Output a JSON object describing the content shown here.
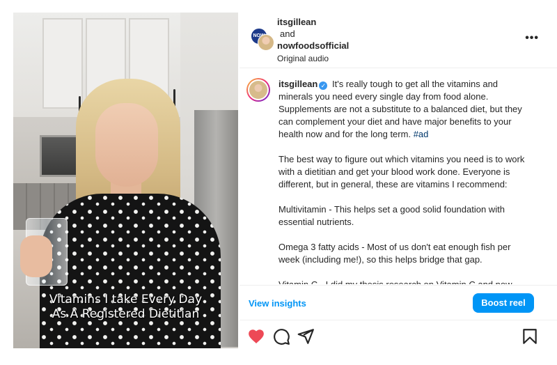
{
  "media": {
    "caption_line1": "Vitamins I take Every Day",
    "caption_line2": "As A Registered Dietitian"
  },
  "header": {
    "author1": "itsgillean",
    "joiner": "and",
    "author2": "nowfoodsofficial",
    "audio": "Original audio",
    "brand_avatar_text": "NOW",
    "more_icon": "more-horizontal-icon"
  },
  "post": {
    "username": "itsgillean",
    "verified_icon": "verified-badge-icon",
    "para1": "It's really tough to get all the vitamins and minerals you need every single day from food alone. Supplements are not a substitute to a balanced diet, but they can complement your diet and have major benefits to your health now and for the long term.",
    "hashtag": "#ad",
    "para2": "The best way to figure out which vitamins you need is to work with a dietitian and get your blood work done. Everyone is different, but in general, these are vitamins I recommend:",
    "para3": "Multivitamin - This helps set a good solid foundation with essential nutrients.",
    "para4": "Omega 3 fatty acids - Most of us don't eat enough fish per week (including me!), so this helps bridge that gap.",
    "para5": "Vitamin C - I did my thesis research on Vitamin C and now take it to support my immune health.*"
  },
  "insights": {
    "view_label": "View insights",
    "boost_label": "Boost reel"
  },
  "actions": {
    "like_icon": "heart-filled-icon",
    "comment_icon": "comment-icon",
    "share_icon": "share-icon",
    "save_icon": "bookmark-icon",
    "like_color": "#ed4956"
  }
}
